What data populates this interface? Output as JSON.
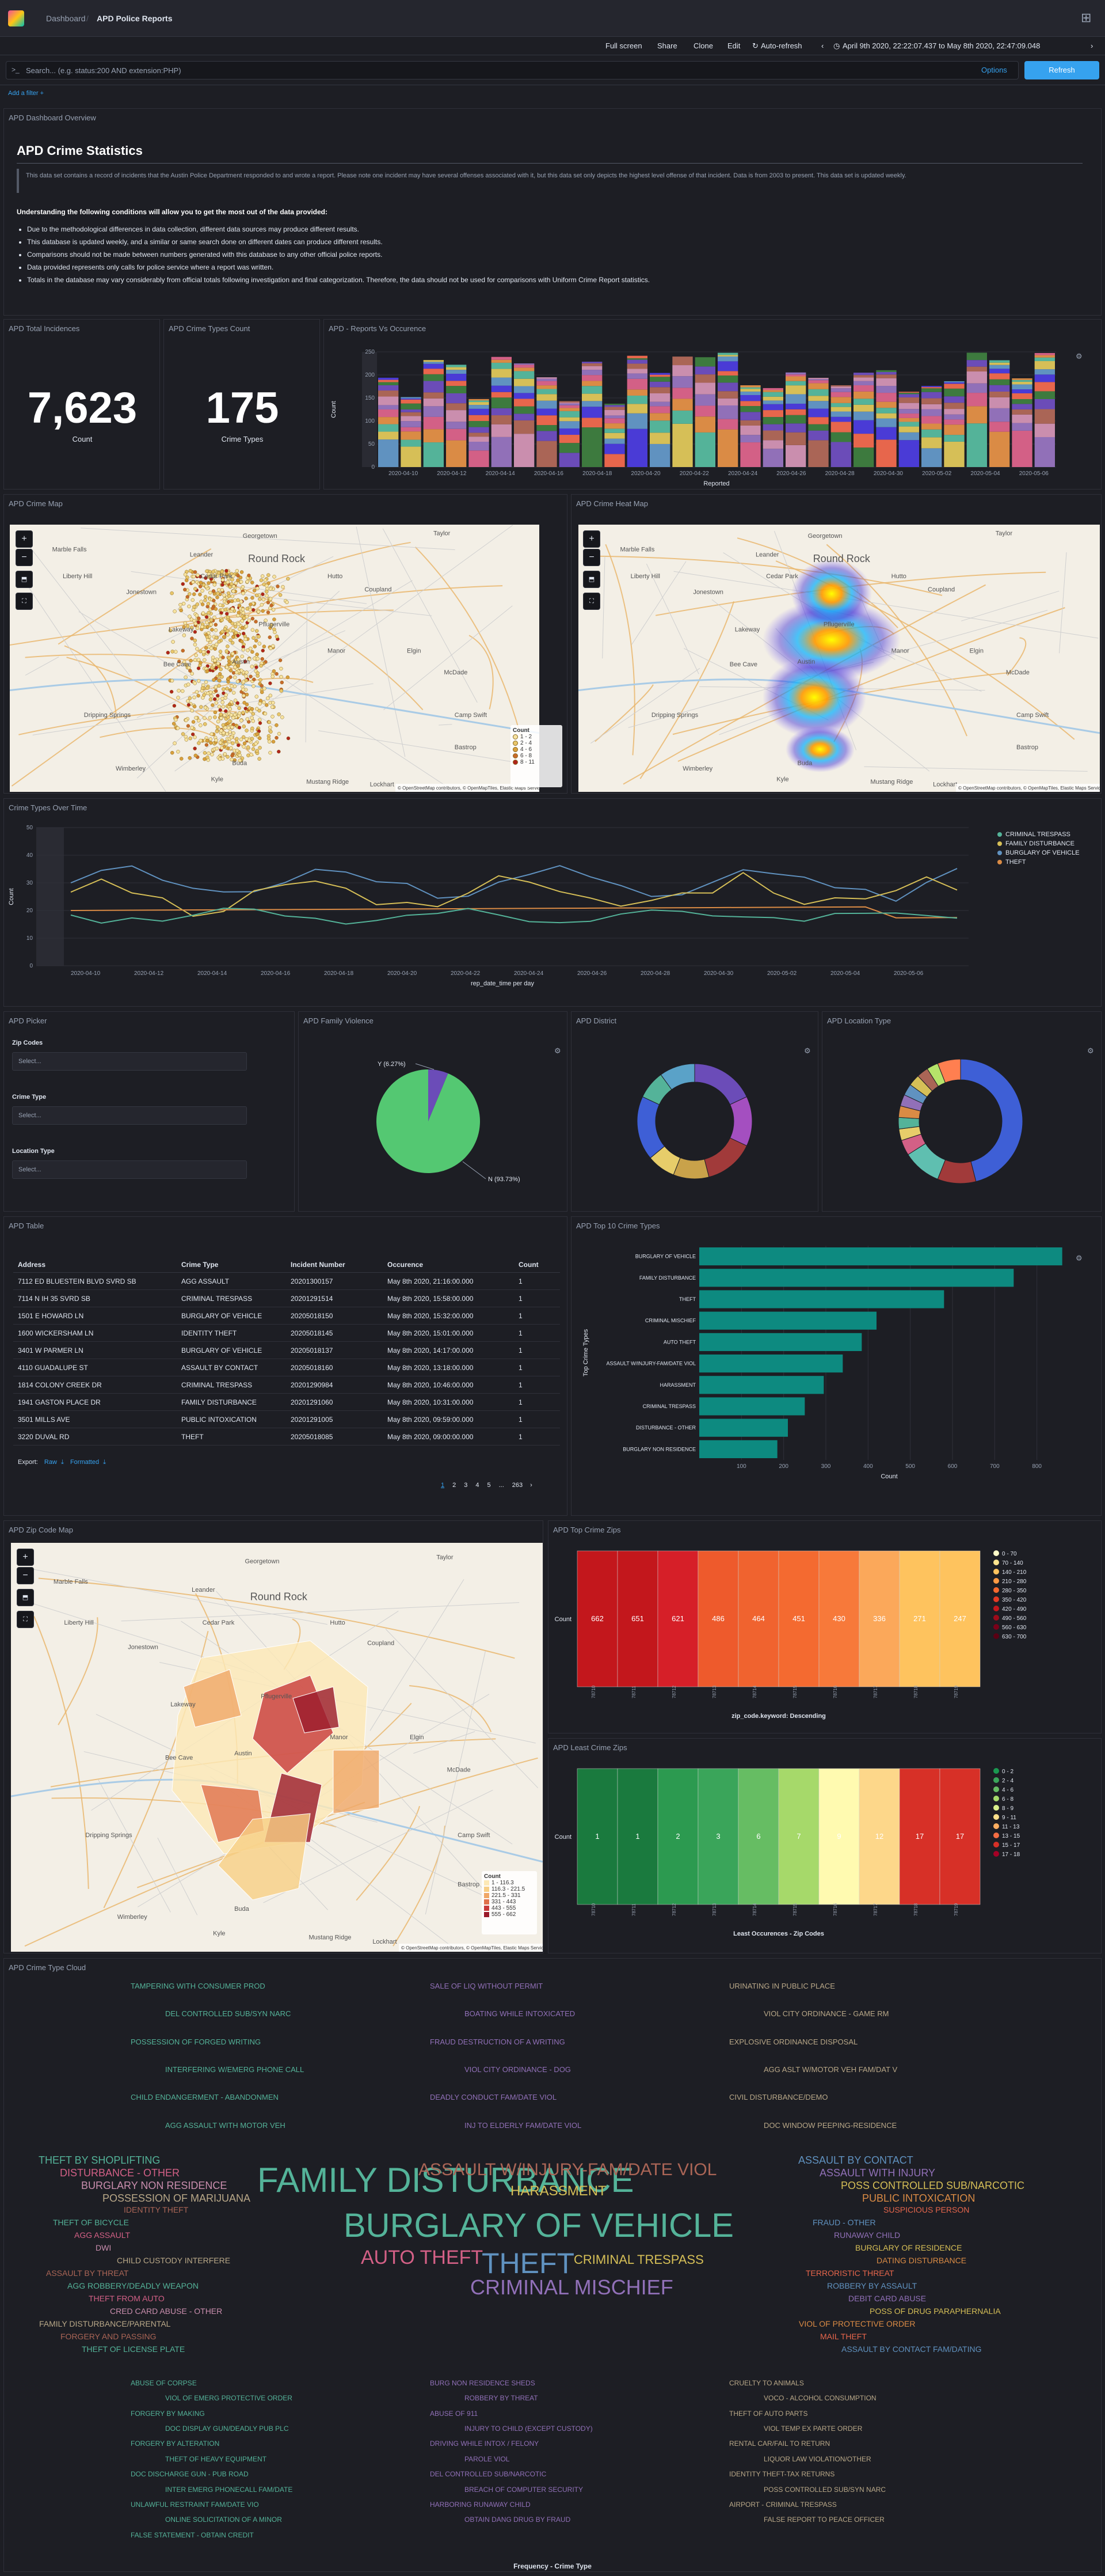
{
  "header": {
    "breadcrumb_root": "Dashboard",
    "breadcrumb_current": "APD Police Reports"
  },
  "nav": {
    "full_screen": "Full screen",
    "share": "Share",
    "clone": "Clone",
    "edit": "Edit",
    "auto_refresh": "Auto-refresh",
    "time_range": "April 9th 2020, 22:22:07.437 to May 8th 2020, 22:47:09.048"
  },
  "query": {
    "placeholder": "Search... (e.g. status:200 AND extension:PHP)",
    "options": "Options",
    "refresh": "Refresh",
    "add_filter": "Add a filter +"
  },
  "overview": {
    "panel_title": "APD Dashboard Overview",
    "heading": "APD Crime Statistics",
    "notice": "This data set contains a record of incidents that the Austin Police Department responded to and wrote a report. Please note one incident may have several offenses associated with it, but this data set only depicts the highest level offense of that incident. Data is from 2003 to present. This data set is updated weekly.",
    "understanding": "Understanding the following conditions will allow you to get the most out of the data provided:",
    "bullets": [
      "Due to the methodological differences in data collection, different data sources may produce different results.",
      "This database is updated weekly, and a similar or same search done on different dates can produce different results.",
      "Comparisons should not be made between numbers generated with this database to any other official police reports.",
      "Data provided represents only calls for police service where a report was written.",
      "Totals in the database may vary considerably from official totals following investigation and final categorization. Therefore, the data should not be used for comparisons with Uniform Crime Report statistics."
    ]
  },
  "metrics": {
    "total_title": "APD Total Incidences",
    "total_value": "7,623",
    "total_label": "Count",
    "types_title": "APD Crime Types Count",
    "types_value": "175",
    "types_label": "Crime Types"
  },
  "reports_chart": {
    "title": "APD - Reports Vs Occurence",
    "ylabel": "Count",
    "xlabel": "Reported",
    "x_ticks": [
      "2020-04-10",
      "2020-04-12",
      "2020-04-14",
      "2020-04-16",
      "2020-04-18",
      "2020-04-20",
      "2020-04-22",
      "2020-04-24",
      "2020-04-26",
      "2020-04-28",
      "2020-04-30",
      "2020-05-02",
      "2020-05-04",
      "2020-05-06"
    ],
    "y_ticks": [
      "0",
      "50",
      "100",
      "150",
      "200",
      "250"
    ]
  },
  "maps": {
    "crime_map_title": "APD Crime Map",
    "heat_map_title": "APD Crime Heat Map",
    "zip_map_title": "APD Zip Code Map",
    "attribution": "© OpenStreetMap contributors, © OpenMapTiles, Elastic Maps Service",
    "places": [
      "Marble Falls",
      "Liberty Hill",
      "Georgetown",
      "Taylor",
      "Round Rock",
      "Pflugerville",
      "Hutto",
      "Coupland",
      "Bee Cave",
      "Manor",
      "Elgin",
      "Dripping Springs",
      "Austin",
      "McDade",
      "Camp Swift",
      "Bastrop",
      "Buda",
      "Mustang Ridge",
      "Lockhart",
      "Kyle",
      "Wimberley",
      "Lakeway",
      "Cedar Park",
      "Leander",
      "Jonestown"
    ],
    "crime_legend_title": "Count",
    "crime_legend": [
      "1 - 2",
      "2 - 4",
      "4 - 6",
      "6 - 8",
      "8 - 11"
    ],
    "zip_legend_title": "Count",
    "zip_legend": [
      "1 - 116.3",
      "116.3 - 221.5",
      "221.5 - 331",
      "331 - 443",
      "443 - 555",
      "555 - 662"
    ]
  },
  "crime_types_over_time": {
    "title": "Crime Types Over Time",
    "ylabel": "Count",
    "xlabel": "rep_date_time per day",
    "x_ticks": [
      "2020-04-10",
      "2020-04-12",
      "2020-04-14",
      "2020-04-16",
      "2020-04-18",
      "2020-04-20",
      "2020-04-22",
      "2020-04-24",
      "2020-04-26",
      "2020-04-28",
      "2020-04-30",
      "2020-05-02",
      "2020-05-04",
      "2020-05-06"
    ],
    "y_ticks": [
      "0",
      "10",
      "20",
      "30",
      "40",
      "50"
    ],
    "legend": [
      {
        "name": "CRIMINAL TRESPASS",
        "color": "#54b399"
      },
      {
        "name": "FAMILY DISTURBANCE",
        "color": "#d6bf57"
      },
      {
        "name": "BURGLARY OF VEHICLE",
        "color": "#6092c0"
      },
      {
        "name": "THEFT",
        "color": "#da8b45"
      }
    ]
  },
  "picker": {
    "title": "APD Picker",
    "zip_label": "Zip Codes",
    "type_label": "Crime Type",
    "location_label": "Location Type",
    "select_placeholder": "Select..."
  },
  "family_violence": {
    "title": "APD Family Violence",
    "label_y": "Y (6.27%)",
    "label_n": "N (93.73%)",
    "y_pct": 6.27,
    "n_pct": 93.73
  },
  "district": {
    "title": "APD District"
  },
  "location_type": {
    "title": "APD Location Type"
  },
  "table": {
    "title": "APD Table",
    "headers": [
      "Address",
      "Crime Type",
      "Incident Number",
      "Occurence",
      "Count"
    ],
    "rows": [
      [
        "7112 ED BLUESTEIN BLVD SVRD SB",
        "AGG ASSAULT",
        "20201300157",
        "May 8th 2020, 21:16:00.000",
        "1"
      ],
      [
        "7114 N IH 35 SVRD SB",
        "CRIMINAL TRESPASS",
        "20201291514",
        "May 8th 2020, 15:58:00.000",
        "1"
      ],
      [
        "1501 E HOWARD LN",
        "BURGLARY OF VEHICLE",
        "20205018150",
        "May 8th 2020, 15:32:00.000",
        "1"
      ],
      [
        "1600 WICKERSHAM LN",
        "IDENTITY THEFT",
        "20205018145",
        "May 8th 2020, 15:01:00.000",
        "1"
      ],
      [
        "3401 W PARMER LN",
        "BURGLARY OF VEHICLE",
        "20205018137",
        "May 8th 2020, 14:17:00.000",
        "1"
      ],
      [
        "4110 GUADALUPE ST",
        "ASSAULT BY CONTACT",
        "20205018160",
        "May 8th 2020, 13:18:00.000",
        "1"
      ],
      [
        "1814 COLONY CREEK DR",
        "CRIMINAL TRESPASS",
        "20201290984",
        "May 8th 2020, 10:46:00.000",
        "1"
      ],
      [
        "1941 GASTON PLACE DR",
        "FAMILY DISTURBANCE",
        "20201291060",
        "May 8th 2020, 10:31:00.000",
        "1"
      ],
      [
        "3501 MILLS AVE",
        "PUBLIC INTOXICATION",
        "20201291005",
        "May 8th 2020, 09:59:00.000",
        "1"
      ],
      [
        "3220 DUVAL RD",
        "THEFT",
        "20205018085",
        "May 8th 2020, 09:00:00.000",
        "1"
      ]
    ],
    "export_label": "Export:",
    "export_raw": "Raw",
    "export_formatted": "Formatted",
    "pages": [
      "1",
      "2",
      "3",
      "4",
      "5",
      "...",
      "263"
    ]
  },
  "top10": {
    "title": "APD Top 10 Crime Types",
    "ylabel": "Top Crime Types",
    "xlabel": "Count",
    "x_ticks": [
      "100",
      "200",
      "300",
      "400",
      "500",
      "600",
      "700",
      "800"
    ]
  },
  "top_zips": {
    "title": "APD Top Crime Zips",
    "row_label": "Count",
    "xlabel": "zip_code.keyword: Descending",
    "legend": [
      "0 - 70",
      "70 - 140",
      "140 - 210",
      "210 - 280",
      "280 - 350",
      "350 - 420",
      "420 - 490",
      "490 - 560",
      "560 - 630",
      "630 - 700"
    ]
  },
  "least_zips": {
    "title": "APD Least Crime Zips",
    "row_label": "Count",
    "xlabel": "Least Occurences - Zip Codes",
    "legend": [
      "0 - 2",
      "2 - 4",
      "4 - 6",
      "6 - 8",
      "8 - 9",
      "9 - 11",
      "11 - 13",
      "13 - 15",
      "15 - 17",
      "17 - 18"
    ]
  },
  "cloud": {
    "title": "APD Crime Type Cloud",
    "xlabel": "Frequency - Crime Type",
    "words_top": [
      "TAMPERING WITH CONSUMER PROD",
      "SALE OF LIQ WITHOUT PERMIT",
      "URINATING IN PUBLIC PLACE",
      "DEL CONTROLLED SUB/SYN NARC",
      "BOATING WHILE INTOXICATED",
      "VIOL CITY ORDINANCE - GAME RM",
      "POSSESSION OF FORGED WRITING",
      "FRAUD DESTRUCTION OF A WRITING",
      "EXPLOSIVE ORDINANCE DISPOSAL",
      "INTERFERING W/EMERG PHONE CALL",
      "VIOL CITY ORDINANCE - DOG",
      "AGG ASLT W/MOTOR VEH FAM/DAT V",
      "CHILD ENDANGERMENT - ABANDONMEN",
      "DEADLY CONDUCT FAM/DATE VIOL",
      "CIVIL DISTURBANCE/DEMO",
      "AGG ASSAULT WITH MOTOR VEH",
      "INJ TO ELDERLY FAM/DATE VIOL",
      "DOC WINDOW PEEPING-RESIDENCE"
    ],
    "words_mid": [
      "FAMILY DISTURBANCE",
      "BURGLARY OF VEHICLE",
      "THEFT",
      "ASSAULT W/INJURY-FAM/DATE VIOL",
      "CRIMINAL MISCHIEF",
      "HARASSMENT",
      "AUTO THEFT",
      "CRIMINAL TRESPASS",
      "THEFT BY SHOPLIFTING",
      "ASSAULT BY CONTACT",
      "DISTURBANCE - OTHER",
      "ASSAULT WITH INJURY",
      "BURGLARY NON RESIDENCE",
      "POSS CONTROLLED SUB/NARCOTIC",
      "POSSESSION OF MARIJUANA",
      "PUBLIC INTOXICATION",
      "IDENTITY THEFT",
      "SUSPICIOUS PERSON",
      "THEFT OF BICYCLE",
      "FRAUD - OTHER",
      "AGG ASSAULT",
      "RUNAWAY CHILD",
      "DWI",
      "BURGLARY OF RESIDENCE",
      "CHILD CUSTODY INTERFERE",
      "DATING DISTURBANCE",
      "ASSAULT BY THREAT",
      "TERRORISTIC THREAT",
      "AGG ROBBERY/DEADLY WEAPON",
      "ROBBERY BY ASSAULT",
      "THEFT FROM AUTO",
      "DEBIT CARD ABUSE",
      "CRED CARD ABUSE - OTHER",
      "POSS OF DRUG PARAPHERNALIA",
      "FAMILY DISTURBANCE/PARENTAL",
      "VIOL OF PROTECTIVE ORDER",
      "FORGERY AND PASSING",
      "MAIL THEFT",
      "THEFT OF LICENSE PLATE",
      "ASSAULT BY CONTACT FAM/DATING"
    ],
    "words_bottom": [
      "ABUSE OF CORPSE",
      "BURG NON RESIDENCE SHEDS",
      "CRUELTY TO ANIMALS",
      "VIOL OF EMERG PROTECTIVE ORDER",
      "ROBBERY BY THREAT",
      "VOCO - ALCOHOL CONSUMPTION",
      "FORGERY BY MAKING",
      "ABUSE OF 911",
      "THEFT OF AUTO PARTS",
      "DOC DISPLAY GUN/DEADLY PUB PLC",
      "INJURY TO CHILD (EXCEPT CUSTODY)",
      "VIOL TEMP EX PARTE ORDER",
      "FORGERY BY ALTERATION",
      "DRIVING WHILE INTOX / FELONY",
      "RENTAL CAR/FAIL TO RETURN",
      "THEFT OF HEAVY EQUIPMENT",
      "PAROLE VIOL",
      "LIQUOR LAW VIOLATION/OTHER",
      "DOC DISCHARGE GUN - PUB ROAD",
      "DEL CONTROLLED SUB/NARCOTIC",
      "IDENTITY THEFT-TAX RETURNS",
      "INTER EMERG PHONECALL FAM/DATE",
      "BREACH OF COMPUTER SECURITY",
      "POSS CONTROLLED SUB/SYN NARC",
      "UNLAWFUL RESTRAINT FAM/DATE VIO",
      "HARBORING RUNAWAY CHILD",
      "AIRPORT - CRIMINAL TRESPASS",
      "ONLINE SOLICITATION OF A MINOR",
      "OBTAIN DANG DRUG BY FRAUD",
      "FALSE REPORT TO PEACE OFFICER",
      "FALSE STATEMENT - OBTAIN CREDIT"
    ]
  }
}
